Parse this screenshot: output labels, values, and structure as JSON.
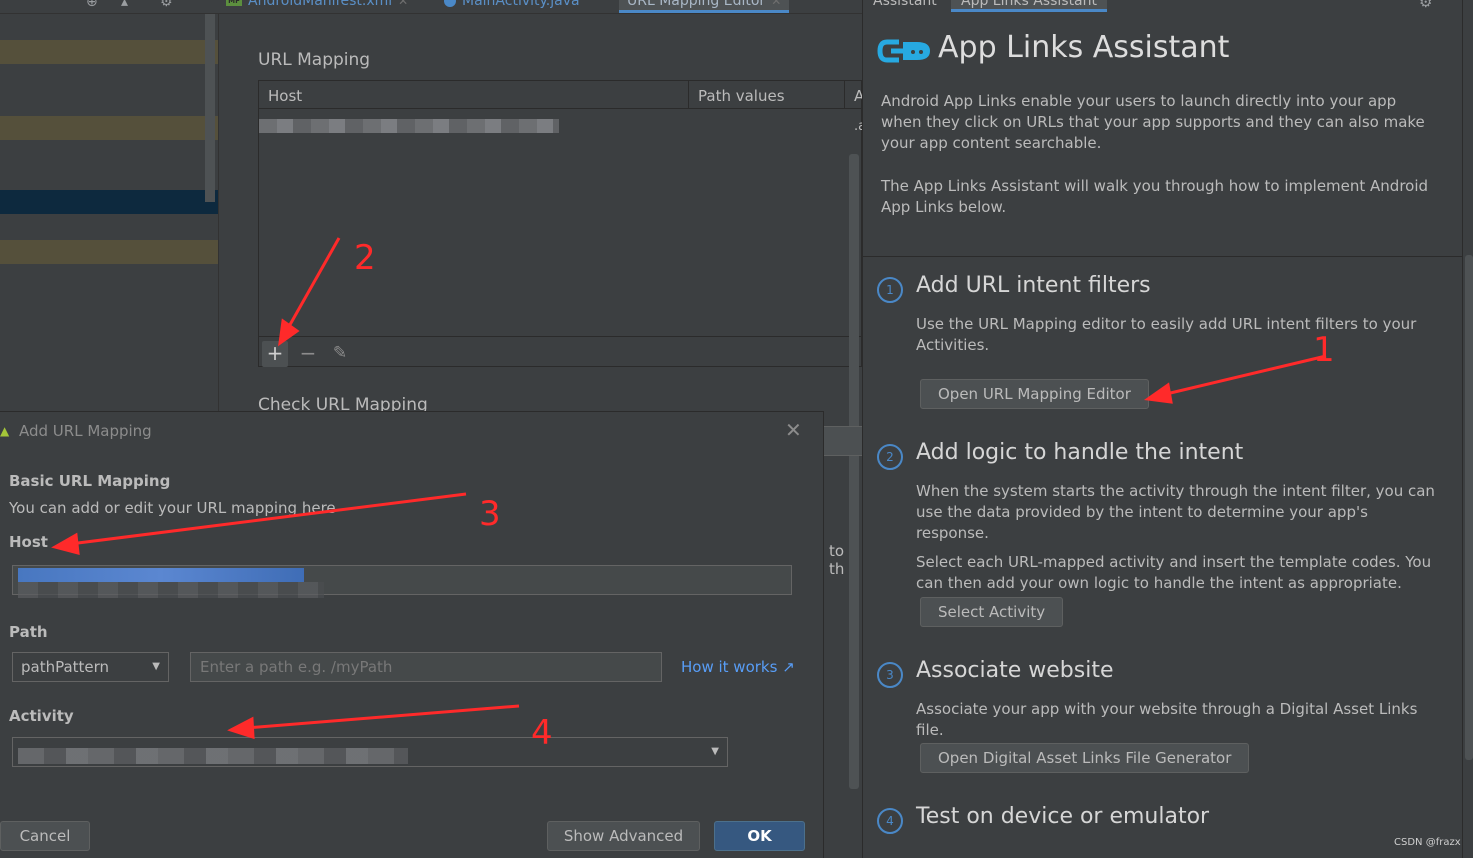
{
  "tabs": [
    {
      "label": "AndroidManifest.xml",
      "badge": "MF"
    },
    {
      "label": "MainActivity.java"
    },
    {
      "label": "URL Mapping Editor"
    }
  ],
  "editor": {
    "title": "URL Mapping",
    "columns": [
      "Host",
      "Path values",
      "A"
    ],
    "row_partial": ".a",
    "check_title": "Check URL Mapping",
    "partial_text": "to th"
  },
  "assistant": {
    "tabs": [
      "Assistant",
      "App Links Assistant"
    ],
    "title": "App Links Assistant",
    "intro": [
      "Android App Links enable your users to launch directly into your app when they click on URLs that your app supports and they can also make your app content searchable.",
      "The App Links Assistant will walk you through how to implement Android App Links below."
    ],
    "steps": [
      {
        "num": "1",
        "title": "Add URL intent filters",
        "body": [
          "Use the URL Mapping editor to easily add URL intent filters to your Activities."
        ],
        "button": "Open URL Mapping Editor"
      },
      {
        "num": "2",
        "title": "Add logic to handle the intent",
        "body": [
          "When the system starts the activity through the intent filter, you can use the data provided by the intent to determine your app's response.",
          "Select each URL-mapped activity and insert the template codes. You can then add your own logic to handle the intent as appropriate."
        ],
        "button": "Select Activity"
      },
      {
        "num": "3",
        "title": "Associate website",
        "body": [
          "Associate your app with your website through a Digital Asset Links file."
        ],
        "button": "Open Digital Asset Links File Generator"
      },
      {
        "num": "4",
        "title": "Test on device or emulator"
      }
    ]
  },
  "dialog": {
    "title": "Add URL Mapping",
    "section_title": "Basic URL Mapping",
    "section_desc": "You can add or edit your URL mapping here",
    "host_label": "Host",
    "path_label": "Path",
    "path_type": "pathPattern",
    "path_placeholder": "Enter a path e.g. /myPath",
    "how_it_works": "How it works ↗",
    "activity_label": "Activity",
    "buttons": {
      "cancel": "Cancel",
      "advanced": "Show Advanced",
      "ok": "OK"
    }
  },
  "annotations": [
    "1",
    "2",
    "3",
    "4"
  ],
  "watermark": "CSDN @frazx",
  "colors": {
    "annotation": "#ff2a2a",
    "accent": "#4a88c7",
    "ok_button": "#365880"
  }
}
